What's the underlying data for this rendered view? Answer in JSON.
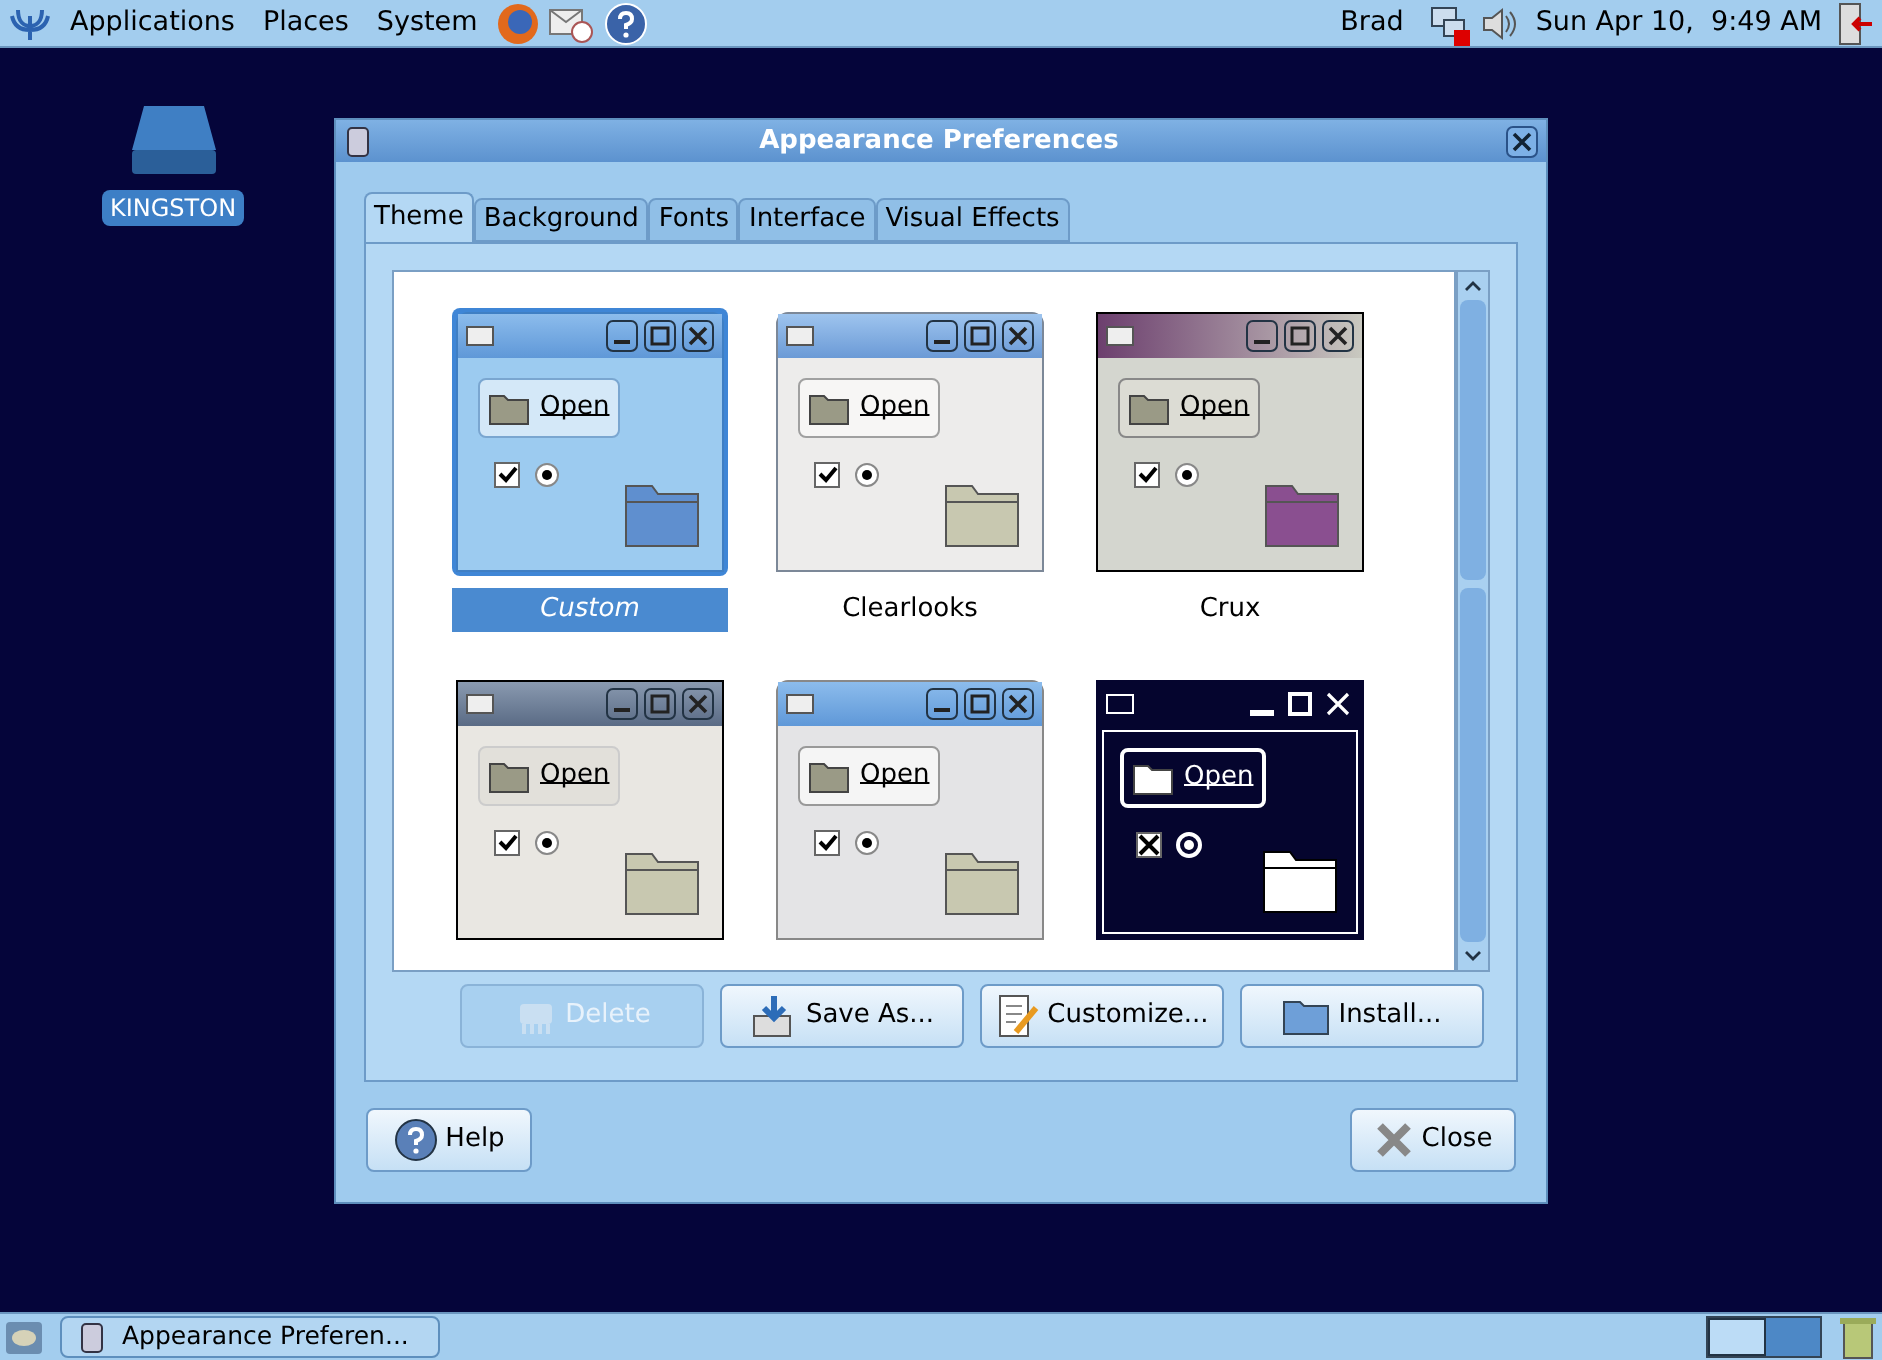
{
  "top_panel": {
    "menus": [
      "Applications",
      "Places",
      "System"
    ],
    "user": "Brad",
    "clock": "Sun Apr 10,  9:49 AM"
  },
  "desktop_icons": [
    {
      "label": "KINGSTON"
    }
  ],
  "window": {
    "title": "Appearance Preferences",
    "tabs": [
      {
        "label": "Theme",
        "selected": true
      },
      {
        "label": "Background",
        "selected": false
      },
      {
        "label": "Fonts",
        "selected": false
      },
      {
        "label": "Interface",
        "selected": false
      },
      {
        "label": "Visual Effects",
        "selected": false
      }
    ],
    "themes": [
      {
        "kind": "blue",
        "name": "Custom",
        "selected": true,
        "button": "Open"
      },
      {
        "kind": "clearlooks",
        "name": "Clearlooks",
        "selected": false,
        "button": "Open"
      },
      {
        "kind": "crux",
        "name": "Crux",
        "selected": false,
        "button": "Open"
      },
      {
        "kind": "glider",
        "selected": false,
        "button": "Open"
      },
      {
        "kind": "gray",
        "selected": false,
        "button": "Open"
      },
      {
        "kind": "contrast",
        "selected": false,
        "button": "Open"
      }
    ],
    "theme_buttons": [
      {
        "kind": "delete",
        "label": "Delete",
        "disabled": true
      },
      {
        "kind": "save",
        "label": "Save As...",
        "disabled": false
      },
      {
        "kind": "customize",
        "label": "Customize...",
        "disabled": false
      },
      {
        "kind": "install",
        "label": "Install...",
        "disabled": false
      }
    ],
    "help_button": "Help",
    "close_button": "Close"
  },
  "taskbar": {
    "tasks": [
      {
        "label": "Appearance Preferen...",
        "selected": false
      }
    ]
  }
}
